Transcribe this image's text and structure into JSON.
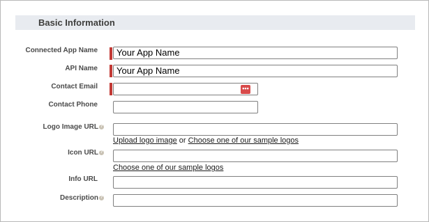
{
  "section": {
    "title": "Basic Information"
  },
  "fields": {
    "connected_app_name": {
      "label": "Connected App Name",
      "value": "Your App Name",
      "required": true
    },
    "api_name": {
      "label": "API Name",
      "value": "Your App Name",
      "required": true
    },
    "contact_email": {
      "label": "Contact Email",
      "value": "",
      "required": true,
      "autofill_icon": "password-manager-icon",
      "autofill_glyph": "•••"
    },
    "contact_phone": {
      "label": "Contact Phone",
      "value": ""
    },
    "logo_image_url": {
      "label": "Logo Image URL",
      "value": "",
      "help_icon": "help-icon",
      "upload_link": "Upload logo image",
      "or_text": "or",
      "sample_link": "Choose one of our sample logos"
    },
    "icon_url": {
      "label": "Icon URL",
      "value": "",
      "help_icon": "help-icon",
      "sample_link": "Choose one of our sample logos"
    },
    "info_url": {
      "label": "Info URL",
      "value": ""
    },
    "description": {
      "label": "Description",
      "value": "",
      "help_icon": "help-icon"
    }
  },
  "colors": {
    "required": "#c23934",
    "header_bg": "#e8ebf0",
    "autofill_icon": "#d84a4a"
  }
}
